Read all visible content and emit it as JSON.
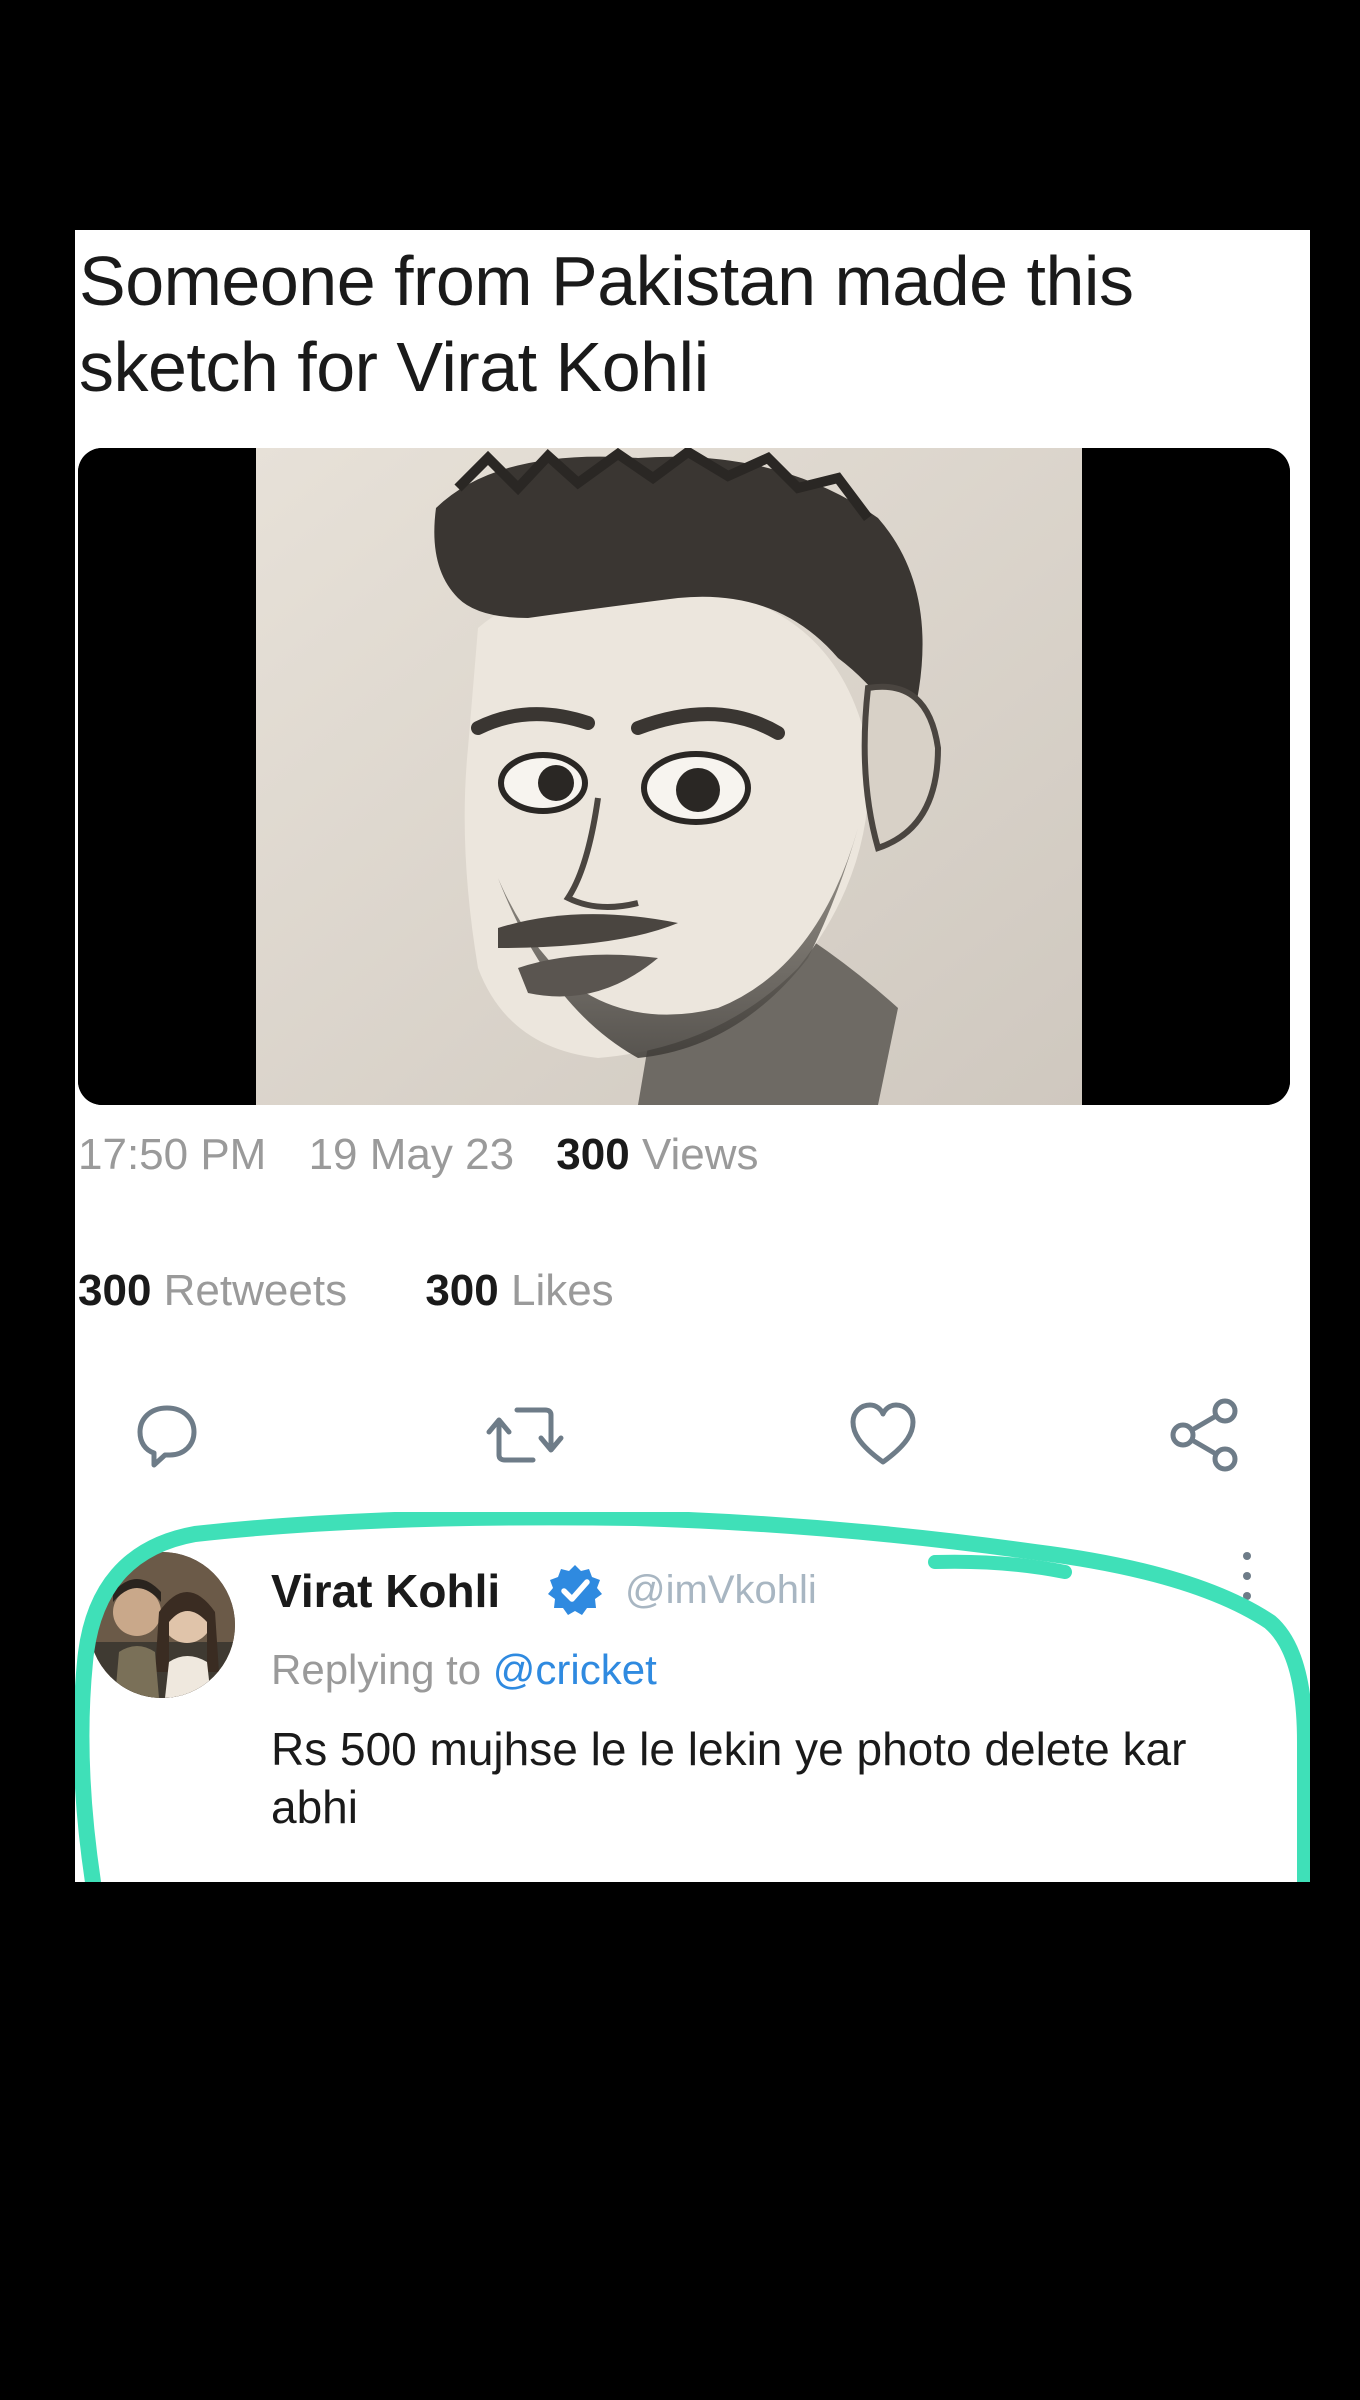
{
  "post": {
    "text": "Someone from Pakistan made this sketch for Virat Kohli",
    "time": "17:50 PM",
    "date": "19 May 23",
    "views_count": "300",
    "views_label": "Views",
    "retweets_count": "300",
    "retweets_label": "Retweets",
    "likes_count": "300",
    "likes_label": "Likes"
  },
  "actions": [
    {
      "icon": "reply-icon"
    },
    {
      "icon": "retweet-icon"
    },
    {
      "icon": "heart-icon"
    },
    {
      "icon": "share-icon"
    }
  ],
  "reply": {
    "name": "Virat Kohli",
    "handle": "@imVkohli",
    "replying_prefix": "Replying to",
    "replying_to": "@cricket",
    "text": "Rs 500 mujhse le le lekin ye photo delete kar abhi"
  },
  "colors": {
    "highlight": "#3fe0b8",
    "verified": "#2f8ae0",
    "mention": "#2f8ae0"
  }
}
